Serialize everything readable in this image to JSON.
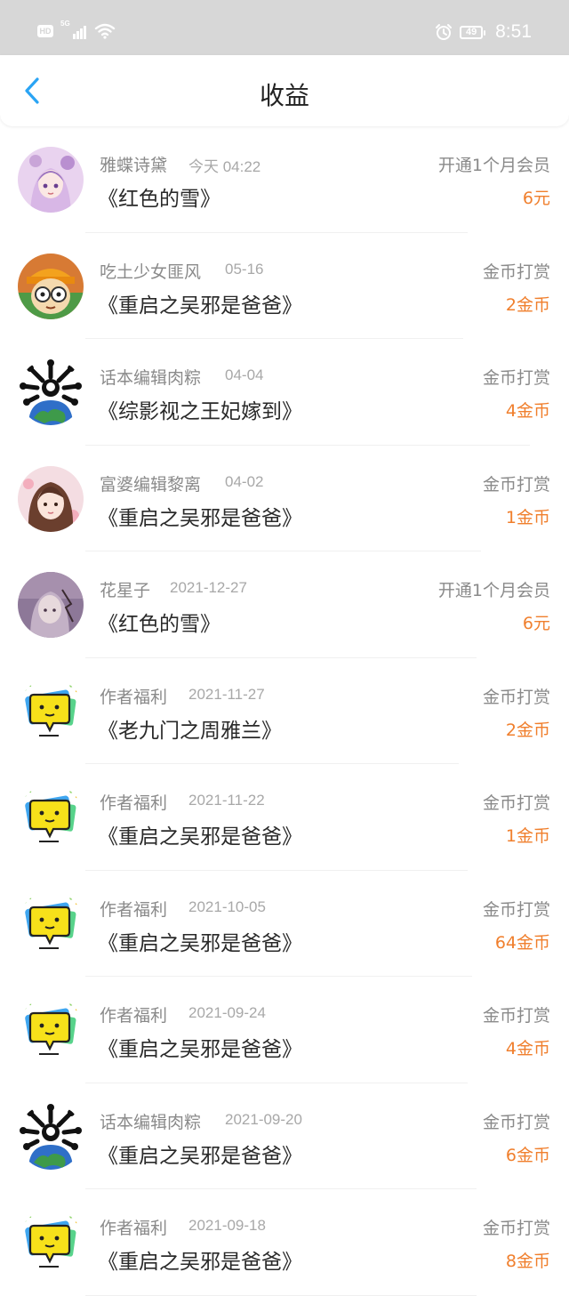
{
  "status_bar": {
    "hd_label": "HD",
    "network_label": "5G",
    "battery": "49",
    "time": "8:51"
  },
  "header": {
    "title": "收益"
  },
  "colors": {
    "accent_blue": "#2aa4f4",
    "amount_orange": "#f07f2d"
  },
  "earnings": [
    {
      "name": "雅蝶诗黛",
      "date": "今天 04:22",
      "book": "《红色的雪》",
      "type": "开通1个月会员",
      "amount": "6元",
      "avatar": "anime-girl-purple"
    },
    {
      "name": "吃土少女匪风",
      "date": "05-16",
      "book": "《重启之吴邪是爸爸》",
      "type": "金币打赏",
      "amount": "2金币",
      "avatar": "cartoon-glasses-boy"
    },
    {
      "name": "话本编辑肉粽",
      "date": "04-04",
      "book": "《综影视之王妃嫁到》",
      "type": "金币打赏",
      "amount": "4金币",
      "avatar": "earth-bones"
    },
    {
      "name": "富婆编辑黎离",
      "date": "04-02",
      "book": "《重启之吴邪是爸爸》",
      "type": "金币打赏",
      "amount": "1金币",
      "avatar": "anime-girl-pink"
    },
    {
      "name": "花星子",
      "date": "2021-12-27",
      "book": "《红色的雪》",
      "type": "开通1个月会员",
      "amount": "6元",
      "avatar": "anime-girl-lilac"
    },
    {
      "name": "作者福利",
      "date": "2021-11-27",
      "book": "《老九门之周雅兰》",
      "type": "金币打赏",
      "amount": "2金币",
      "avatar": "yellow-speech-bubble"
    },
    {
      "name": "作者福利",
      "date": "2021-11-22",
      "book": "《重启之吴邪是爸爸》",
      "type": "金币打赏",
      "amount": "1金币",
      "avatar": "yellow-speech-bubble"
    },
    {
      "name": "作者福利",
      "date": "2021-10-05",
      "book": "《重启之吴邪是爸爸》",
      "type": "金币打赏",
      "amount": "64金币",
      "avatar": "yellow-speech-bubble"
    },
    {
      "name": "作者福利",
      "date": "2021-09-24",
      "book": "《重启之吴邪是爸爸》",
      "type": "金币打赏",
      "amount": "4金币",
      "avatar": "yellow-speech-bubble"
    },
    {
      "name": "话本编辑肉粽",
      "date": "2021-09-20",
      "book": "《重启之吴邪是爸爸》",
      "type": "金币打赏",
      "amount": "6金币",
      "avatar": "earth-bones"
    },
    {
      "name": "作者福利",
      "date": "2021-09-18",
      "book": "《重启之吴邪是爸爸》",
      "type": "金币打赏",
      "amount": "8金币",
      "avatar": "yellow-speech-bubble"
    }
  ]
}
